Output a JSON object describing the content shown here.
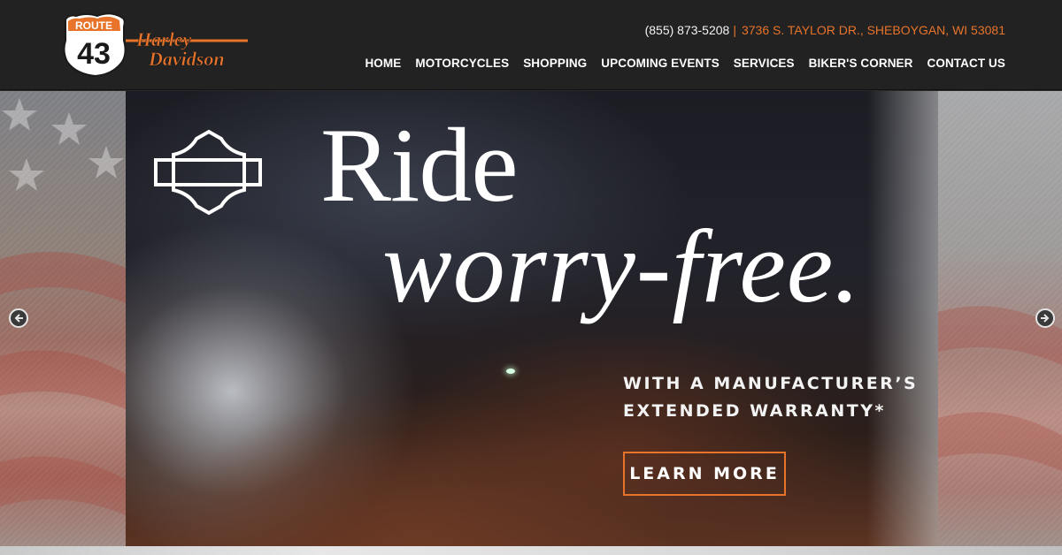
{
  "header": {
    "logo": {
      "route_label": "ROUTE",
      "route_number": "43",
      "brand_line1": "Harley",
      "brand_line2": "Davidson"
    },
    "phone": "(855) 873-5208",
    "separator": "|",
    "address": "3736 S. TAYLOR DR., SHEBOYGAN, WI 53081"
  },
  "nav": {
    "items": [
      {
        "label": "HOME"
      },
      {
        "label": "MOTORCYCLES"
      },
      {
        "label": "SHOPPING"
      },
      {
        "label": "UPCOMING EVENTS"
      },
      {
        "label": "SERVICES"
      },
      {
        "label": "BIKER'S CORNER"
      },
      {
        "label": "CONTACT US"
      }
    ]
  },
  "hero": {
    "headline_line1": "Ride",
    "headline_line2": "worry-free.",
    "subline_line1": "WITH A MANUFACTURER’S",
    "subline_line2": "EXTENDED WARRANTY*",
    "cta_label": "LEARN MORE"
  },
  "slider": {
    "prev_icon": "arrow-left-icon",
    "next_icon": "arrow-right-icon"
  },
  "colors": {
    "accent": "#e8732a",
    "header_bg": "#222222",
    "text_light": "#ffffff"
  }
}
